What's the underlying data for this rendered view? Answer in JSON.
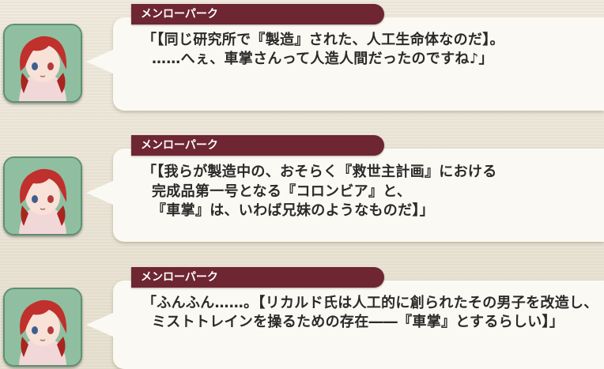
{
  "messages": [
    {
      "speaker": "メンローパーク",
      "lines": [
        "「【同じ研究所で『製造』された、人工生命体なのだ】。",
        "……へぇ、車掌さんって人造人間だったのですね♪」"
      ]
    },
    {
      "speaker": "メンローパーク",
      "lines": [
        "「【我らが製造中の、おそらく『救世主計画』における",
        "完成品第一号となる『コロンビア』と、",
        "『車掌』は、いわば兄妹のようなものだ】」"
      ]
    },
    {
      "speaker": "メンローパーク",
      "lines": [
        "「ふんふん……。【リカルド氏は人工的に創られたその男子を改造し、",
        "ミストトレインを操るための存在――『車掌』とするらしい】」"
      ]
    }
  ],
  "colors": {
    "nameplate": "#6e2633",
    "bubble": "#fbf9f3",
    "avatar_frame": "#9bc7a9",
    "text": "#2a2a2a"
  },
  "icons": [
    "character-portrait-icon"
  ]
}
